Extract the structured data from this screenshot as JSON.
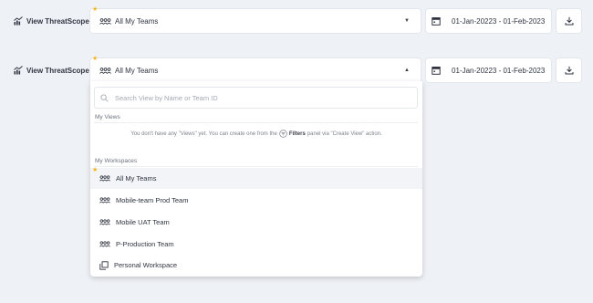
{
  "header": {
    "view_label": "View ThreatScope™",
    "selected_team": "All My Teams",
    "date_range": "01-Jan-20223  -  01-Feb-2023"
  },
  "dropdown": {
    "search_placeholder": "Search View by Name or Team ID",
    "views_section_title": "My Views",
    "views_empty_pre": "You don't have any  \"Views\" yet.  You can create one from the",
    "views_empty_filters": "Filters",
    "views_empty_post": "panel via \"Create View\" action.",
    "workspaces_section_title": "My Workspaces",
    "items": [
      {
        "label": "All My Teams",
        "icon": "teams-icon"
      },
      {
        "label": "Mobile-team Prod Team",
        "icon": "teams-icon"
      },
      {
        "label": "Mobile UAT Team",
        "icon": "teams-icon"
      },
      {
        "label": "P-Production Team",
        "icon": "teams-icon"
      },
      {
        "label": "Personal Workspace",
        "icon": "workspace-icon"
      }
    ]
  },
  "colors": {
    "accent_star": "#f2b51c",
    "background": "#eef1f5"
  }
}
